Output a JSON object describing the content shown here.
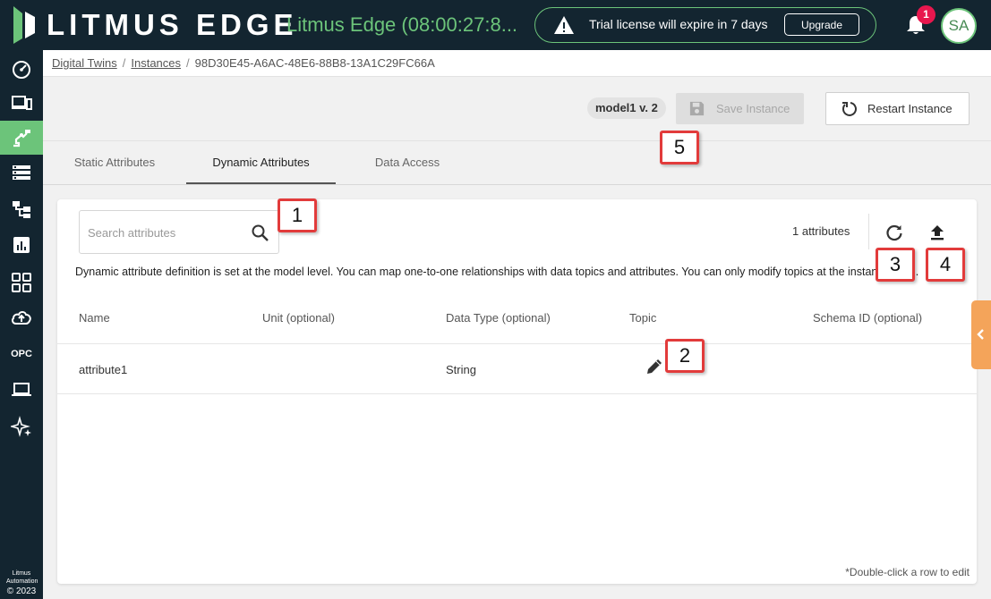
{
  "header": {
    "brand": "LITMUS EDGE",
    "device_name": "Litmus Edge (08:00:27:8...",
    "trial_text": "Trial license will expire in 7 days",
    "upgrade_label": "Upgrade",
    "notification_count": "1",
    "avatar_initials": "SA"
  },
  "sidebar": {
    "items": [
      {
        "icon": "dashboard-gauge-icon"
      },
      {
        "icon": "devices-icon"
      },
      {
        "icon": "digital-twins-icon",
        "active": true
      },
      {
        "icon": "data-list-icon"
      },
      {
        "icon": "flows-icon"
      },
      {
        "icon": "analytics-icon"
      },
      {
        "icon": "applications-grid-icon"
      },
      {
        "icon": "cloud-upload-icon"
      },
      {
        "label": "OPC"
      },
      {
        "icon": "laptop-icon"
      },
      {
        "icon": "sparkle-icon"
      }
    ],
    "footer_company": "Litmus Automation",
    "footer_year": "© 2023"
  },
  "breadcrumb": {
    "items": [
      "Digital Twins",
      "Instances"
    ],
    "current": "98D30E45-A6AC-48E6-88B8-13A1C29FC66A",
    "separator": "/"
  },
  "actions": {
    "model_version": "model1 v. 2",
    "save_label": "Save Instance",
    "restart_label": "Restart Instance"
  },
  "tabs": [
    {
      "label": "Static Attributes"
    },
    {
      "label": "Dynamic Attributes",
      "active": true
    },
    {
      "label": "Data Access"
    }
  ],
  "panel": {
    "search_placeholder": "Search attributes",
    "count_text": "1 attributes",
    "description": "Dynamic attribute definition is set at the model level. You can map one-to-one relationships with data topics and attributes. You can only modify topics at the instance level.",
    "columns": [
      "Name",
      "Unit (optional)",
      "Data Type (optional)",
      "Topic",
      "Schema ID (optional)"
    ],
    "rows": [
      {
        "name": "attribute1",
        "unit": "",
        "data_type": "String",
        "topic": "",
        "schema_id": ""
      }
    ],
    "footnote": "*Double-click a row to edit"
  },
  "callouts": [
    "1",
    "2",
    "3",
    "4",
    "5"
  ],
  "colors": {
    "topbar": "#132530",
    "accent_green": "#6cc47a",
    "callout_red": "#e23b3b",
    "collapse_orange": "#f4a45a",
    "badge_pink": "#e8174e"
  }
}
